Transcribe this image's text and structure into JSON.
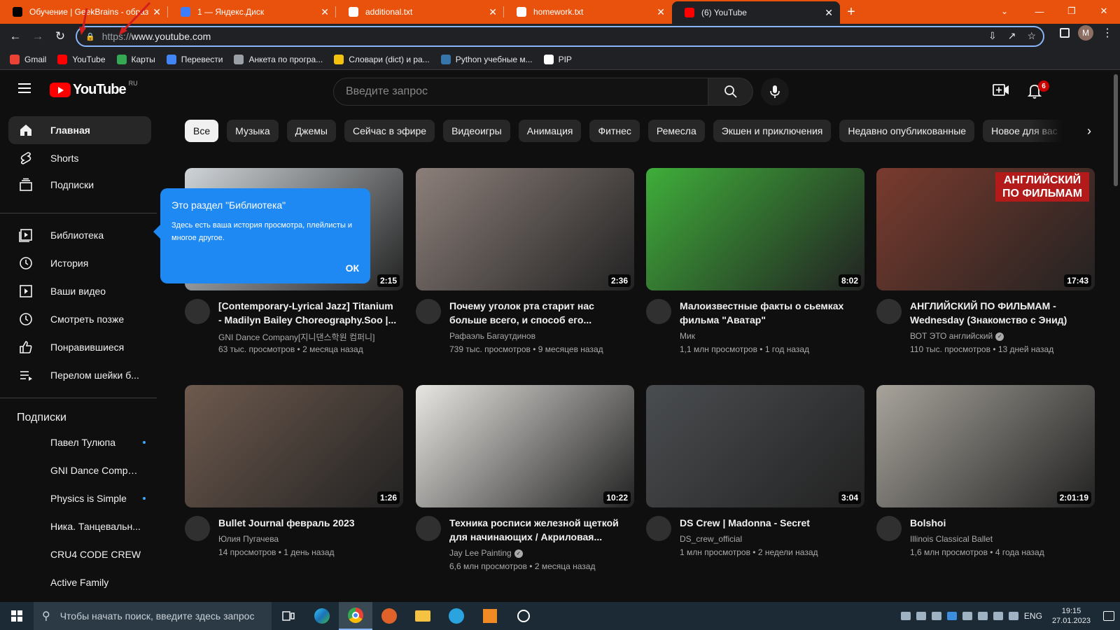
{
  "browser": {
    "tabs": [
      {
        "label": "Обучение | GeekBrains - образо",
        "favicon_color": "#000000"
      },
      {
        "label": "1 — Яндекс.Диск",
        "favicon_color": "#3f7dff"
      },
      {
        "label": "additional.txt",
        "favicon_color": "#ffffff"
      },
      {
        "label": "homework.txt",
        "favicon_color": "#ffffff"
      },
      {
        "label": "(6) YouTube",
        "favicon_color": "#ff0000",
        "active": true
      }
    ],
    "close_glyph": "✕",
    "newtab_glyph": "+",
    "url_scheme": "https://",
    "url_host": "www.youtube.com",
    "profile_initial": "M",
    "bookmarks": [
      {
        "label": "Gmail",
        "color": "#ea4335"
      },
      {
        "label": "YouTube",
        "color": "#ff0000"
      },
      {
        "label": "Карты",
        "color": "#34a853"
      },
      {
        "label": "Перевести",
        "color": "#4285f4"
      },
      {
        "label": "Анкета по програ...",
        "color": "#9aa0a6"
      },
      {
        "label": "Словари (dict) и ра...",
        "color": "#f4c20d"
      },
      {
        "label": "Python учебные м...",
        "color": "#3776ab"
      },
      {
        "label": "PIP",
        "color": "#ffffff"
      }
    ]
  },
  "youtube": {
    "logo_text": "YouTube",
    "logo_region": "RU",
    "search_placeholder": "Введите запрос",
    "notifications_count": "6",
    "sidebar": {
      "main": [
        {
          "label": "Главная",
          "icon": "home-icon",
          "active": true
        },
        {
          "label": "Shorts",
          "icon": "shorts-icon"
        },
        {
          "label": "Подписки",
          "icon": "subscriptions-icon"
        }
      ],
      "library": [
        {
          "label": "Библиотека",
          "icon": "library-icon"
        },
        {
          "label": "История",
          "icon": "history-icon"
        },
        {
          "label": "Ваши видео",
          "icon": "your-videos-icon"
        },
        {
          "label": "Смотреть позже",
          "icon": "watch-later-icon"
        },
        {
          "label": "Понравившиеся",
          "icon": "liked-icon"
        },
        {
          "label": "Перелом шейки б...",
          "icon": "playlist-icon"
        }
      ],
      "subs_title": "Подписки",
      "subs": [
        {
          "name": "Павел Тулюпа",
          "new": true
        },
        {
          "name": "GNI Dance Compan...",
          "new": false
        },
        {
          "name": "Physics is Simple",
          "new": true
        },
        {
          "name": "Ника. Танцевальн...",
          "new": false
        },
        {
          "name": "CRU4 CODE CREW",
          "new": false
        },
        {
          "name": "Active Family",
          "new": false
        }
      ]
    },
    "chips": [
      "Все",
      "Музыка",
      "Джемы",
      "Сейчас в эфире",
      "Видеоигры",
      "Анимация",
      "Фитнес",
      "Ремесла",
      "Экшен и приключения",
      "Недавно опубликованные",
      "Новое для вас"
    ],
    "popup": {
      "title": "Это раздел \"Библиотека\"",
      "text": "Здесь есть ваша история просмотра, плейлисты и многое другое.",
      "ok": "ОК"
    },
    "videos": [
      {
        "title": "[Contemporary-Lyrical Jazz] Titanium - Madilyn Bailey Choreography.Soo |...",
        "channel": "GNI Dance Company[지니댄스학원 컴퍼니]",
        "stats": "63 тыс. просмотров • 2 месяца назад",
        "duration": "2:15",
        "verified": false,
        "color": "#cfd4d8"
      },
      {
        "title": "Почему уголок рта старит нас больше всего, и способ его...",
        "channel": "Рафаэль Багаутдинов",
        "stats": "739 тыс. просмотров • 9 месяцев назад",
        "duration": "2:36",
        "verified": false,
        "color": "#8c7f7a"
      },
      {
        "title": "Малоизвестные факты о сьемках фильма \"Аватар\"",
        "channel": "Мик",
        "stats": "1,1 млн просмотров • 1 год назад",
        "duration": "8:02",
        "verified": false,
        "color": "#3fae3a"
      },
      {
        "title": "АНГЛИЙСКИЙ ПО ФИЛЬМАМ - Wednesday (Знакомство с Энид)",
        "channel": "ВОТ ЭТО английский",
        "stats": "110 тыс. просмотров • 13 дней назад",
        "duration": "17:43",
        "verified": true,
        "color": "#7a3b2e",
        "thumb_text": "АНГЛИЙСКИЙ ПО ФИЛЬМАМ"
      },
      {
        "title": "Bullet Journal февраль 2023",
        "channel": "Юлия Пугачева",
        "stats": "14 просмотров • 1 день назад",
        "duration": "1:26",
        "verified": false,
        "color": "#6e5a4e"
      },
      {
        "title": "Техника росписи железной щеткой для начинающих / Акриловая...",
        "channel": "Jay Lee Painting",
        "stats": "6,6 млн просмотров • 2 месяца назад",
        "duration": "10:22",
        "verified": true,
        "color": "#e8e6e2"
      },
      {
        "title": "DS Crew | Madonna - Secret",
        "channel": "DS_crew_official",
        "stats": "1 млн просмотров • 2 недели назад",
        "duration": "3:04",
        "verified": false,
        "color": "#4a4d50"
      },
      {
        "title": "Bolshoi",
        "channel": "Illinois Classical Ballet",
        "stats": "1,6 млн просмотров • 4 года назад",
        "duration": "2:01:19",
        "verified": false,
        "color": "#a8a49c"
      }
    ]
  },
  "taskbar": {
    "search_placeholder": "Чтобы начать поиск, введите здесь запрос",
    "lang": "ENG",
    "time": "19:15",
    "date": "27.01.2023"
  }
}
